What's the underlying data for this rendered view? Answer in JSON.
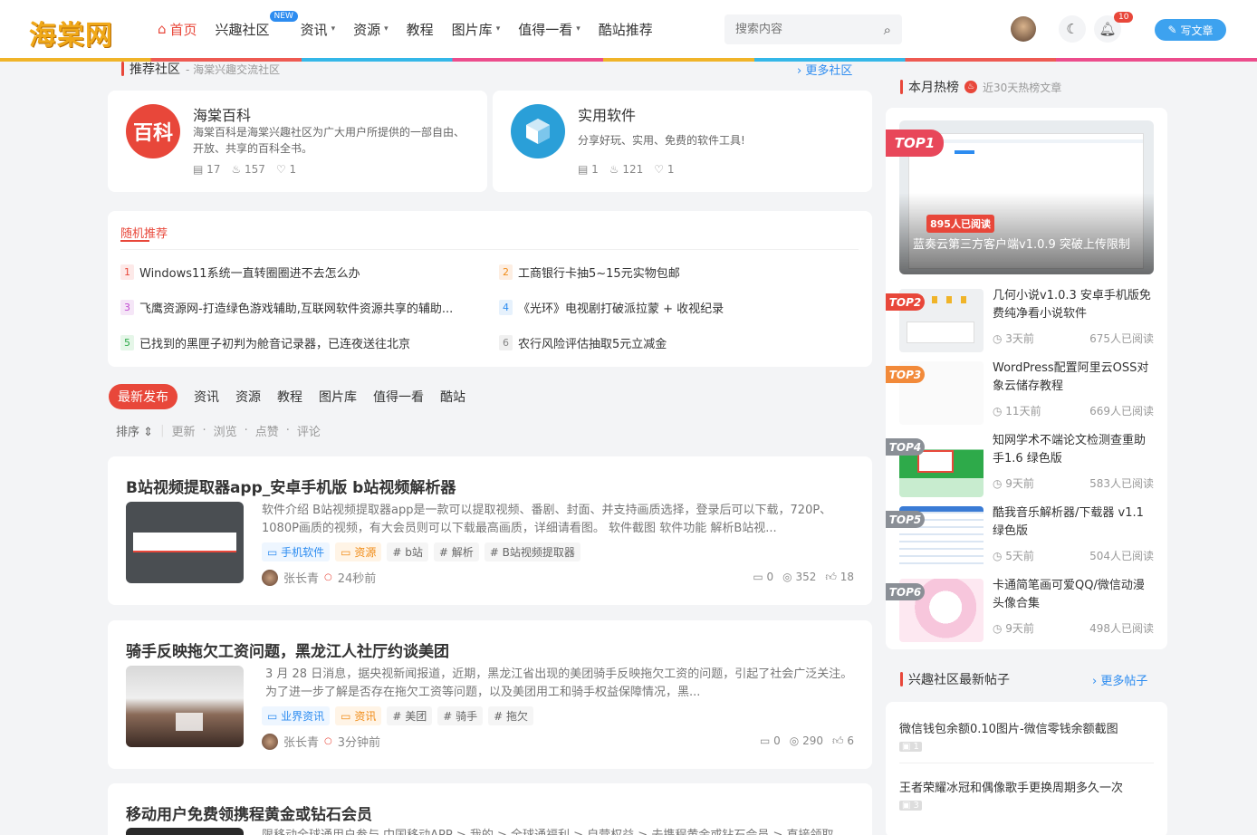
{
  "site": {
    "logo": "海棠网"
  },
  "nav": {
    "home": "首页",
    "community": "兴趣社区",
    "new_badge": "NEW",
    "news": "资讯",
    "resources": "资源",
    "tutorials": "教程",
    "gallery": "图片库",
    "worth": "值得一看",
    "cool": "酷站推荐"
  },
  "search": {
    "placeholder": "搜索内容"
  },
  "user": {
    "notif_count": "10",
    "write_label": "写文章"
  },
  "rec": {
    "title": "推荐社区",
    "sub": "- 海棠兴趣交流社区",
    "more": "更多社区",
    "cards": [
      {
        "icon_text": "百科",
        "title": "海棠百科",
        "desc": "海棠百科是海棠兴趣社区为广大用户所提供的一部自由、开放、共享的百科全书。",
        "posts": "17",
        "heat": "157",
        "likes": "1"
      },
      {
        "icon_text": "",
        "title": "实用软件",
        "desc": "分享好玩、实用、免费的软件工具!",
        "posts": "1",
        "heat": "121",
        "likes": "1"
      }
    ]
  },
  "random": {
    "title": "随机推荐",
    "items": [
      {
        "n": "1",
        "text": "Windows11系统一直转圈圈进不去怎么办"
      },
      {
        "n": "2",
        "text": "工商银行卡抽5~15元实物包邮"
      },
      {
        "n": "3",
        "text": "飞鹰资源网-打造绿色游戏辅助,互联网软件资源共享的辅助..."
      },
      {
        "n": "4",
        "text": "《光环》电视剧打破派拉蒙 + 收视纪录"
      },
      {
        "n": "5",
        "text": "已找到的黑匣子初判为舱音记录器，已连夜送往北京"
      },
      {
        "n": "6",
        "text": "农行风险评估抽取5元立减金"
      }
    ]
  },
  "tabs": [
    "最新发布",
    "资讯",
    "资源",
    "教程",
    "图片库",
    "值得一看",
    "酷站"
  ],
  "sort": {
    "label": "排序",
    "options": [
      "更新",
      "浏览",
      "点赞",
      "评论"
    ]
  },
  "posts": [
    {
      "title": "B站视频提取器app_安卓手机版 b站视频解析器",
      "desc": "软件介绍 B站视频提取器app是一款可以提取视频、番剧、封面、并支持画质选择，登录后可以下载，720P、1080P画质的视频，有大会员则可以下载最高画质，详细请看图。 软件截图 软件功能 解析B站视...",
      "tags": [
        "手机软件",
        "资源",
        "# b站",
        "# 解析",
        "# B站视频提取器"
      ],
      "author": "张长青",
      "time": "24秒前",
      "comments": "0",
      "views": "352",
      "likes": "18"
    },
    {
      "title": "骑手反映拖欠工资问题，黑龙江人社厅约谈美团",
      "desc": "3 月 28 日消息，据央视新闻报道，近期，黑龙江省出现的美团骑手反映拖欠工资的问题，引起了社会广泛关注。 为了进一步了解是否存在拖欠工资等问题，以及美团用工和骑手权益保障情况，黑...",
      "tags": [
        "业界资讯",
        "资讯",
        "# 美团",
        "# 骑手",
        "# 拖欠"
      ],
      "author": "张长青",
      "time": "3分钟前",
      "comments": "0",
      "views": "290",
      "likes": "6"
    },
    {
      "title": "移动用户免费领携程黄金或钻石会员",
      "desc": "限移动全球通用户参与 中国移动APP > 我的 > 全球通福利 > 自营权益 > 去携程黄金或钻石会员 > 直接领取"
    }
  ],
  "hot": {
    "title": "本月热榜",
    "sub": "近30天热榜文章",
    "top1": {
      "label": "TOP1",
      "reads": "895人已阅读",
      "title": "蓝奏云第三方客户端v1.0.9 突破上传限制"
    },
    "items": [
      {
        "label": "TOP2",
        "title": "几何小说v1.0.3 安卓手机版免费纯净看小说软件",
        "time": "3天前",
        "reads": "675人已阅读"
      },
      {
        "label": "TOP3",
        "title": "WordPress配置阿里云OSS对象云储存教程",
        "time": "11天前",
        "reads": "669人已阅读"
      },
      {
        "label": "TOP4",
        "title": "知网学术不端论文检测查重助手1.6 绿色版",
        "time": "9天前",
        "reads": "583人已阅读"
      },
      {
        "label": "TOP5",
        "title": "酷我音乐解析器/下载器 v1.1 绿色版",
        "time": "5天前",
        "reads": "504人已阅读"
      },
      {
        "label": "TOP6",
        "title": "卡通简笔画可爱QQ/微信动漫头像合集",
        "time": "9天前",
        "reads": "498人已阅读"
      }
    ]
  },
  "bbs": {
    "title": "兴趣社区最新帖子",
    "more": "更多帖子",
    "items": [
      {
        "title": "微信钱包余额0.10图片-微信零钱余额截图",
        "imgs": "1"
      },
      {
        "title": "王者荣耀冰冠和偶像歌手更换周期多久一次",
        "imgs": "3"
      }
    ]
  },
  "colors": {
    "accent": "#e8473a",
    "blue": "#2d8cf0",
    "write_btn": "#3da2ef"
  }
}
